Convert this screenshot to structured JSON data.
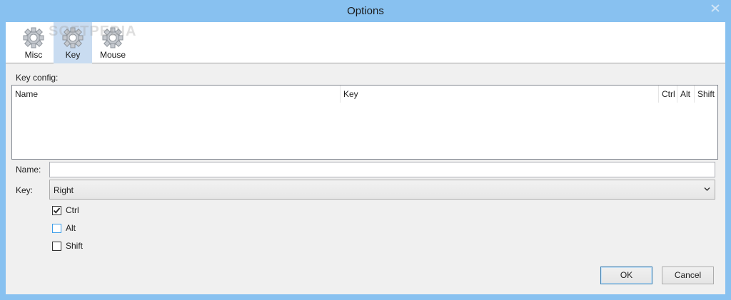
{
  "window": {
    "title": "Options"
  },
  "toolbar": {
    "watermark": "SOFTPEDIA",
    "buttons": [
      {
        "label": "Misc",
        "icon": "gear-icon",
        "active": false
      },
      {
        "label": "Key",
        "icon": "gear-icon",
        "active": true
      },
      {
        "label": "Mouse",
        "icon": "gear-icon",
        "active": false
      }
    ]
  },
  "key_config": {
    "label": "Key config:",
    "columns": [
      "Name",
      "Key",
      "Ctrl",
      "Alt",
      "Shift"
    ],
    "rows": []
  },
  "form": {
    "name_label": "Name:",
    "name_value": "",
    "key_label": "Key:",
    "key_value": "Right",
    "modifiers": [
      {
        "label": "Ctrl",
        "checked": true
      },
      {
        "label": "Alt",
        "checked": false
      },
      {
        "label": "Shift",
        "checked": false
      }
    ]
  },
  "buttons": {
    "ok": "OK",
    "cancel": "Cancel"
  },
  "colors": {
    "titlebar": "#88c1f0",
    "active_tab": "#c9dcf1",
    "focus": "#3c9de8"
  }
}
